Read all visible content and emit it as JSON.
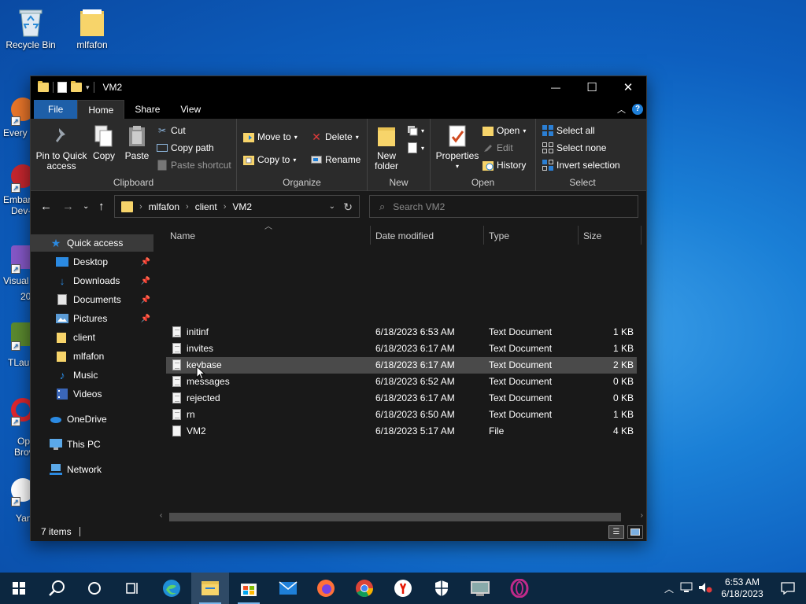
{
  "desktop": {
    "icons": [
      {
        "label": "Recycle Bin"
      },
      {
        "label": "mlfafon"
      }
    ],
    "edge_labels": [
      "Every",
      "Embar",
      "Dev-",
      "Visual",
      "20",
      "TLaur",
      "Op",
      "Brov",
      "Yan"
    ]
  },
  "window": {
    "title": "VM2",
    "controls": {
      "minimize": "—",
      "maximize": "☐",
      "close": "✕"
    }
  },
  "ribbon": {
    "tabs": {
      "file": "File",
      "home": "Home",
      "share": "Share",
      "view": "View"
    },
    "clipboard": {
      "label": "Clipboard",
      "pin": "Pin to Quick access",
      "copy": "Copy",
      "paste": "Paste",
      "cut": "Cut",
      "copy_path": "Copy path",
      "paste_shortcut": "Paste shortcut"
    },
    "organize": {
      "label": "Organize",
      "move_to": "Move to",
      "copy_to": "Copy to",
      "delete": "Delete",
      "rename": "Rename"
    },
    "new": {
      "label": "New",
      "new_folder": "New folder"
    },
    "open": {
      "label": "Open",
      "properties": "Properties",
      "open": "Open",
      "edit": "Edit",
      "history": "History"
    },
    "select": {
      "label": "Select",
      "select_all": "Select all",
      "select_none": "Select none",
      "invert": "Invert selection"
    }
  },
  "address": {
    "crumbs": [
      "mlfafon",
      "client",
      "VM2"
    ],
    "search_placeholder": "Search VM2"
  },
  "navpane": {
    "quick_access": "Quick access",
    "items": [
      {
        "label": "Desktop",
        "pinned": true
      },
      {
        "label": "Downloads",
        "pinned": true
      },
      {
        "label": "Documents",
        "pinned": true
      },
      {
        "label": "Pictures",
        "pinned": true
      },
      {
        "label": "client",
        "pinned": false
      },
      {
        "label": "mlfafon",
        "pinned": false
      },
      {
        "label": "Music",
        "pinned": false
      },
      {
        "label": "Videos",
        "pinned": false
      }
    ],
    "onedrive": "OneDrive",
    "this_pc": "This PC",
    "network": "Network"
  },
  "files": {
    "columns": {
      "name": "Name",
      "date": "Date modified",
      "type": "Type",
      "size": "Size"
    },
    "rows": [
      {
        "name": "initinf",
        "date": "6/18/2023 6:53 AM",
        "type": "Text Document",
        "size": "1 KB"
      },
      {
        "name": "invites",
        "date": "6/18/2023 6:17 AM",
        "type": "Text Document",
        "size": "1 KB"
      },
      {
        "name": "keybase",
        "date": "6/18/2023 6:17 AM",
        "type": "Text Document",
        "size": "2 KB"
      },
      {
        "name": "messages",
        "date": "6/18/2023 6:52 AM",
        "type": "Text Document",
        "size": "0 KB"
      },
      {
        "name": "rejected",
        "date": "6/18/2023 6:17 AM",
        "type": "Text Document",
        "size": "0 KB"
      },
      {
        "name": "rn",
        "date": "6/18/2023 6:50 AM",
        "type": "Text Document",
        "size": "1 KB"
      },
      {
        "name": "VM2",
        "date": "6/18/2023 5:17 AM",
        "type": "File",
        "size": "4 KB"
      }
    ]
  },
  "status": {
    "items": "7 items"
  },
  "taskbar": {
    "apps": [
      "start",
      "search",
      "cortana",
      "task-view",
      "edge",
      "file-explorer",
      "store",
      "mail",
      "firefox",
      "chrome",
      "yandex",
      "security",
      "remote-desktop",
      "opera"
    ],
    "clock_time": "6:53 AM",
    "clock_date": "6/18/2023"
  }
}
